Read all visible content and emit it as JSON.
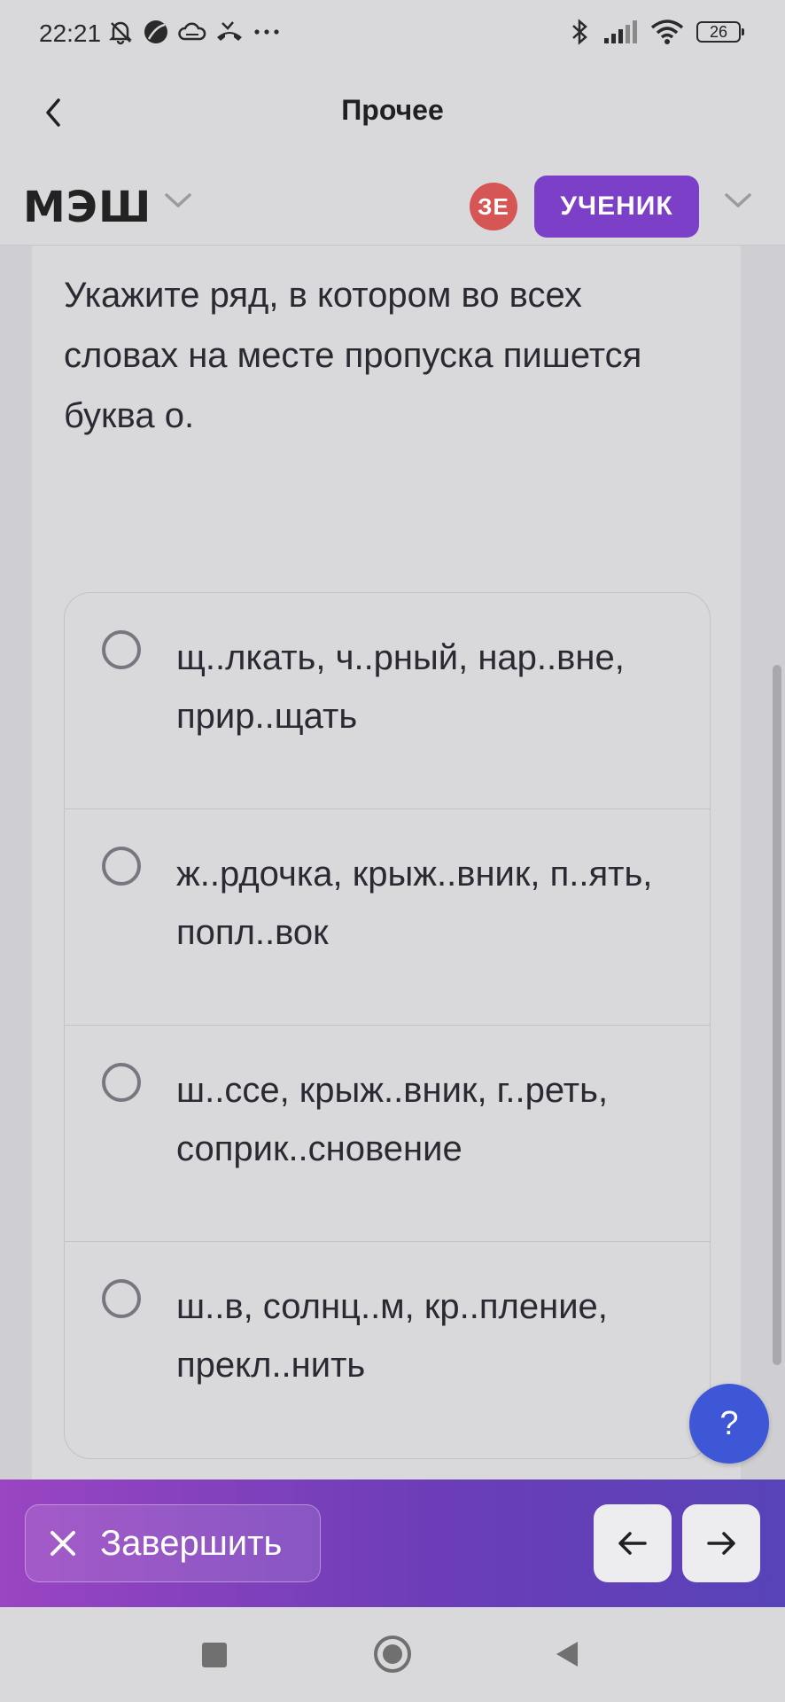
{
  "status_bar": {
    "time": "22:21",
    "left_icons": [
      "mute-icon",
      "moon-icon",
      "cloud-icon",
      "missed-call-icon",
      "more-dots-icon"
    ],
    "battery": "26",
    "right_icons": [
      "bluetooth-icon",
      "signal-icon",
      "wifi-icon",
      "battery-icon"
    ]
  },
  "header": {
    "title": "Прочее",
    "back_icon": "chevron-left-icon"
  },
  "app_bar": {
    "logo": "МЭШ",
    "avatar_initials": "ЗЕ",
    "avatar_color": "#d65656",
    "role": "УЧЕНИК",
    "role_color": "#7b3fc8"
  },
  "question": {
    "text": "Укажите ряд, в котором во всех словах на месте пропуска пишется буква о."
  },
  "options": [
    {
      "text": "щ..лкать, ч..рный, нар..вне, прир..щать"
    },
    {
      "text": "ж..рдочка, крыж..вник, п..ять, попл..вок"
    },
    {
      "text": "ш..ссе, крыж..вник, г..реть, соприк..сновение"
    },
    {
      "text": "ш..в, солнц..м, кр..пление, прекл..нить"
    }
  ],
  "help_button": {
    "label": "?",
    "color": "#3e57d6"
  },
  "action_bar": {
    "finish_label": "Завершить",
    "prev_icon": "arrow-left-icon",
    "next_icon": "arrow-right-icon"
  }
}
